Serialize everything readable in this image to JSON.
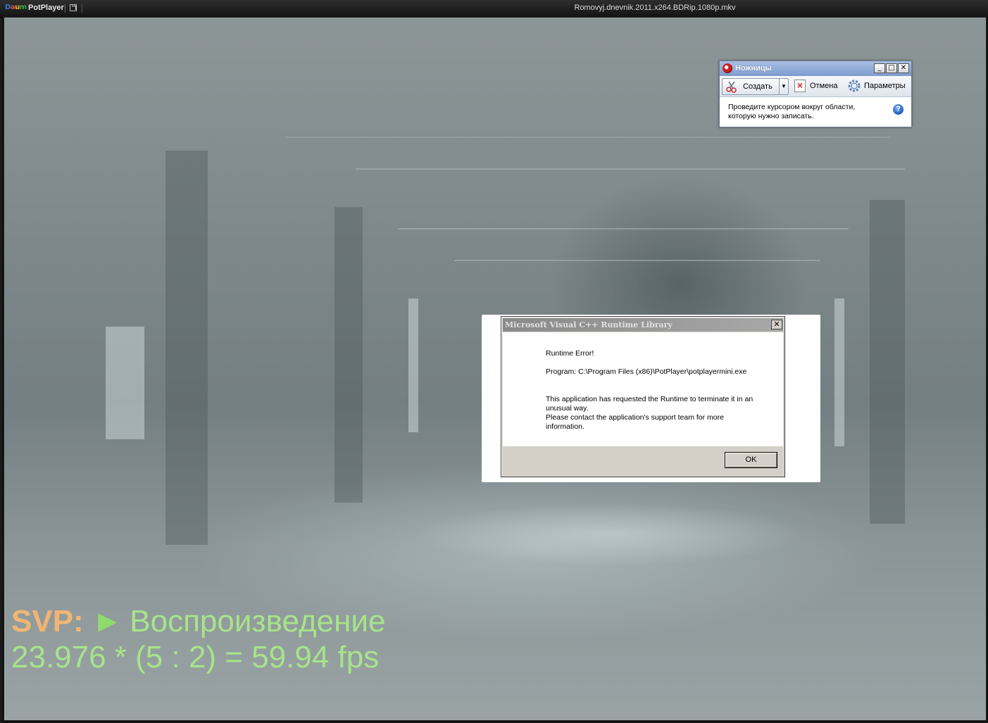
{
  "player": {
    "logo_text": "Daum",
    "app_name": "PotPlayer",
    "file_title": "Romovyj.dnevnik.2011.x264.BDRip.1080p.mkv"
  },
  "svp": {
    "label": "SVP:",
    "play_glyph": "►",
    "state": "Воспроизведение",
    "fps_line": "23.976 * (5 : 2) = 59.94 fps"
  },
  "snipping_tool": {
    "title": "Ножницы",
    "create_label": "Создать",
    "dropdown_glyph": "▼",
    "cancel_label": "Отмена",
    "options_label": "Параметры",
    "message_line1": "Проведите курсором вокруг области,",
    "message_line2": "которую нужно записать.",
    "help_glyph": "?",
    "minimize_glyph": "_",
    "maximize_glyph": "□",
    "close_glyph": "✕"
  },
  "error_dialog": {
    "title": "Microsoft Visual C++ Runtime Library",
    "close_glyph": "✕",
    "heading": "Runtime Error!",
    "program": "Program: C:\\Program Files (x86)\\PotPlayer\\potplayermini.exe",
    "message_line1": "This application has requested the Runtime to terminate it in an",
    "message_line2": "unusual way.",
    "message_line3": "Please contact the application's support team for more",
    "message_line4": "information.",
    "ok_label": "OK"
  },
  "colors": {
    "svp_label": "#f0b574",
    "svp_text": "#a6e48a",
    "snip_titlebar": "#7d9cd0"
  }
}
